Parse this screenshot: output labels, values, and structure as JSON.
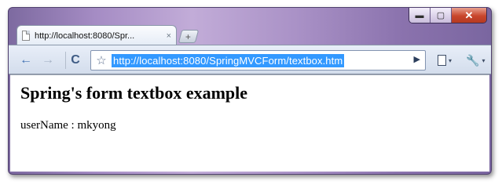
{
  "window": {
    "controls": {
      "minimize": "▬",
      "maximize": "▢",
      "close": "✕"
    }
  },
  "tab": {
    "title": "http://localhost:8080/Spr...",
    "close": "×",
    "new_tab": "+"
  },
  "toolbar": {
    "back": "←",
    "forward": "→",
    "reload": "C",
    "bookmark_star": "☆",
    "url": "http://localhost:8080/SpringMVCForm/textbox.htm",
    "go": "▶",
    "page_menu_caret": "▾",
    "wrench": "🔧",
    "wrench_menu_caret": "▾"
  },
  "page": {
    "heading": "Spring's form textbox example",
    "field_line": "userName : mkyong"
  }
}
